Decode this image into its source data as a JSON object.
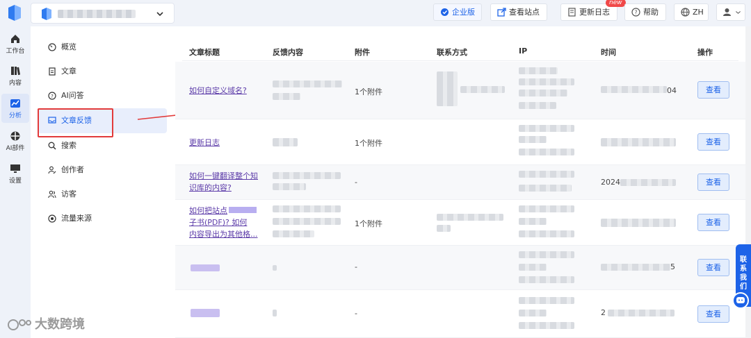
{
  "rail": {
    "items": [
      {
        "label": "工作台",
        "icon": "home-icon"
      },
      {
        "label": "内容",
        "icon": "book-icon"
      },
      {
        "label": "分析",
        "icon": "chart-icon"
      },
      {
        "label": "AI部件",
        "icon": "widget-icon"
      },
      {
        "label": "设置",
        "icon": "monitor-icon"
      }
    ]
  },
  "topbar": {
    "enterprise": "企业版",
    "view_site": "查看站点",
    "changelog": "更新日志",
    "new_badge": "new",
    "help": "帮助",
    "lang": "ZH"
  },
  "menu": {
    "items": [
      {
        "label": "概览"
      },
      {
        "label": "文章"
      },
      {
        "label": "AI问答"
      },
      {
        "label": "文章反馈"
      },
      {
        "label": "搜索"
      },
      {
        "label": "创作者"
      },
      {
        "label": "访客"
      },
      {
        "label": "流量来源"
      }
    ]
  },
  "table": {
    "headers": [
      "文章标题",
      "反馈内容",
      "附件",
      "联系方式",
      "IP",
      "时间",
      "操作"
    ],
    "rows": [
      {
        "title": "如何自定义域名?",
        "attachment": "1个附件",
        "time_suffix": "04",
        "action": "查看"
      },
      {
        "title": "更新日志",
        "attachment": "1个附件",
        "time_suffix": "",
        "action": "查看"
      },
      {
        "title": "如何一键翻译整个知识库的内容?",
        "attachment": "-",
        "time_prefix": "2024",
        "action": "查看"
      },
      {
        "title_line1": "如何把站点",
        "title_line2": "子书(PDF)? 如何",
        "title_line3": "内容导出为其他格...",
        "attachment": "1个附件",
        "action": "查看"
      },
      {
        "title": "",
        "attachment": "-",
        "time_suffix": "5",
        "action": "查看"
      },
      {
        "title": "",
        "attachment": "-",
        "time_prefix": "2",
        "action": "查看"
      }
    ]
  },
  "contact_tab": "联系我们",
  "watermark": "大数跨境",
  "colors": {
    "accent": "#1d63e8",
    "highlight": "#e23a3a",
    "link": "#5b3aa8"
  }
}
